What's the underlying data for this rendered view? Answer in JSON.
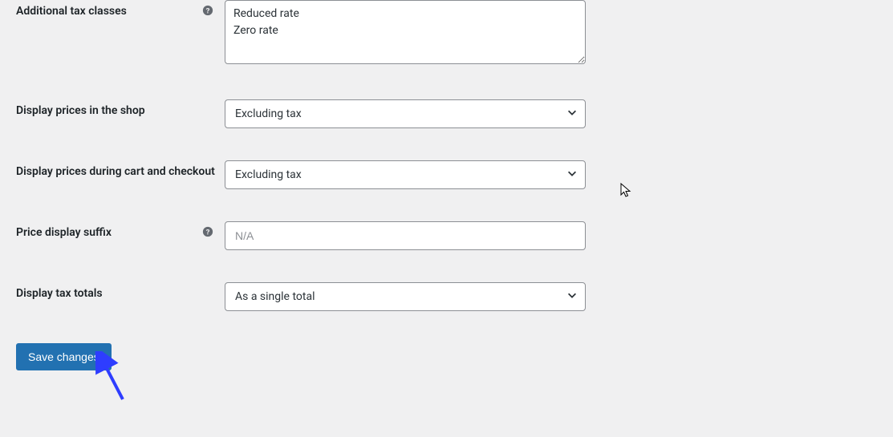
{
  "form": {
    "additional_tax_classes": {
      "label": "Additional tax classes",
      "value": "Reduced rate\nZero rate"
    },
    "display_prices_shop": {
      "label": "Display prices in the shop",
      "selected": "Excluding tax"
    },
    "display_prices_cart": {
      "label": "Display prices during cart and checkout",
      "selected": "Excluding tax"
    },
    "price_display_suffix": {
      "label": "Price display suffix",
      "placeholder": "N/A",
      "value": ""
    },
    "display_tax_totals": {
      "label": "Display tax totals",
      "selected": "As a single total"
    }
  },
  "actions": {
    "save_label": "Save changes"
  }
}
